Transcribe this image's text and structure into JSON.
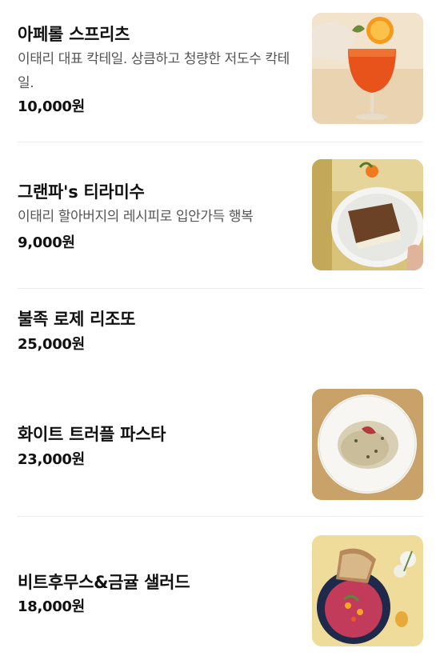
{
  "menu": {
    "items": [
      {
        "name": "아페롤 스프리츠",
        "description": "이태리 대표 칵테일. 상큼하고 청량한 저도수 칵테일.",
        "price": "10,000원",
        "photo_icon": "aperol-spritz-photo"
      },
      {
        "name": "그랜파's 티라미수",
        "description": "이태리 할아버지의 레시피로 입안가득 행복",
        "price": "9,000원",
        "photo_icon": "tiramisu-photo"
      },
      {
        "name": "불족 로제 리조또",
        "price": "25,000원"
      },
      {
        "name": "화이트 트러플 파스타",
        "price": "23,000원",
        "photo_icon": "truffle-pasta-photo"
      },
      {
        "name": "비트후무스&금귤 샐러드",
        "price": "18,000원",
        "photo_icon": "beet-hummus-salad-photo"
      }
    ]
  },
  "colors": {
    "name_text": "#111111",
    "desc_text": "#555555",
    "divider": "#ececec"
  }
}
